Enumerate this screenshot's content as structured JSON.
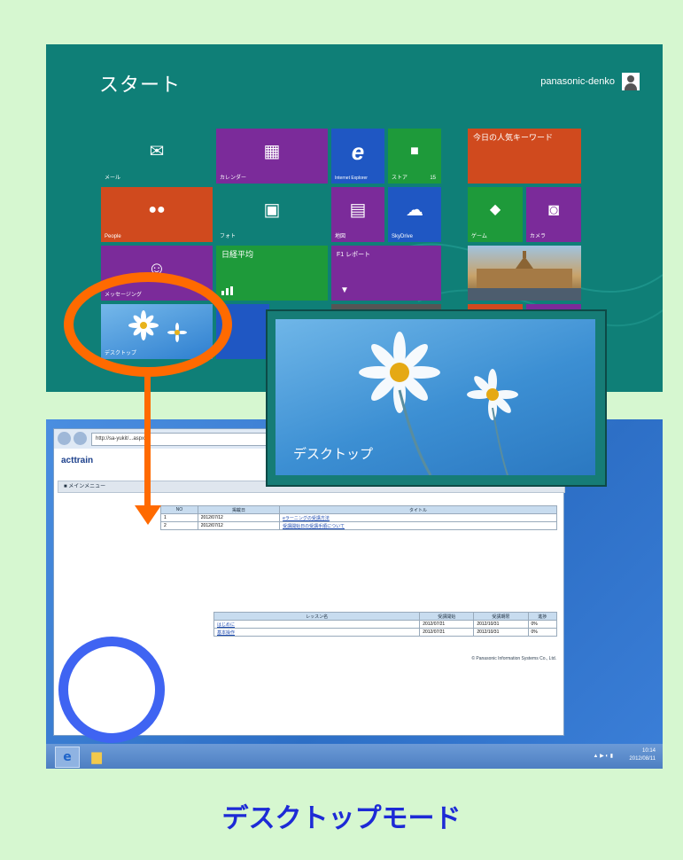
{
  "start_screen": {
    "title": "スタート",
    "user_name": "panasonic-denko",
    "tiles": [
      {
        "id": "mail",
        "label": "メール",
        "icon": "✉",
        "color": "#0f7f77"
      },
      {
        "id": "calendar",
        "label": "カレンダー",
        "icon": "▦",
        "color": "#7b2b9a"
      },
      {
        "id": "ie",
        "label": "Internet Explorer",
        "icon": "e",
        "color": "#1f57c3"
      },
      {
        "id": "store",
        "label": "ストア",
        "icon": "🛍",
        "color": "#1e9a3a",
        "badge": "15"
      },
      {
        "id": "news",
        "text": "今日の人気キーワード",
        "color": "#d04a1e"
      },
      {
        "id": "people",
        "label": "People",
        "icon": "👥",
        "color": "#d04a1e"
      },
      {
        "id": "photos",
        "label": "フォト",
        "icon": "▣",
        "color": "#0f7f77"
      },
      {
        "id": "maps",
        "label": "地図",
        "icon": "▤",
        "color": "#7b2b9a"
      },
      {
        "id": "skydrive",
        "label": "SkyDrive",
        "icon": "☁",
        "color": "#1f57c3"
      },
      {
        "id": "games",
        "label": "ゲーム",
        "icon": "🎮",
        "color": "#1e9a3a"
      },
      {
        "id": "camera",
        "label": "カメラ",
        "icon": "◙",
        "color": "#7b2b9a"
      },
      {
        "id": "messaging",
        "label": "メッセージング",
        "icon": "☺",
        "color": "#7b2b9a"
      },
      {
        "id": "finance",
        "text": "日経平均",
        "color": "#1e9a3a"
      },
      {
        "id": "sports",
        "text": "F1 レポート",
        "color": "#7b2b9a"
      },
      {
        "id": "desktop",
        "label": "デスクトップ",
        "color": "#2e7fd0"
      }
    ]
  },
  "desktop_view": {
    "address": "http://sa-yukit/...aspx",
    "logo_text": "acttrain",
    "menu_label": "メインメニュー",
    "table1": {
      "headers": [
        "NO",
        "掲載日",
        "タイトル"
      ],
      "rows": [
        [
          "1",
          "2012/07/12",
          "eラーニングの受講方法"
        ],
        [
          "2",
          "2012/07/12",
          "受講開始日の受講手順について"
        ]
      ]
    },
    "table2": {
      "headers": [
        "レッスン名",
        "受講開始",
        "受講期限",
        "進捗"
      ],
      "rows": [
        [
          "はじめに",
          "2012/07/21",
          "2012/10/31",
          "0%"
        ],
        [
          "基本操作",
          "2012/07/21",
          "2012/10/31",
          "0%"
        ]
      ]
    },
    "copyright": "© Panasonic Information Systems Co., Ltd.",
    "clock": {
      "time": "10:14",
      "date": "2012/08/11"
    }
  },
  "zoom_tile": {
    "label": "デスクトップ"
  },
  "caption": "デスクトップモード"
}
